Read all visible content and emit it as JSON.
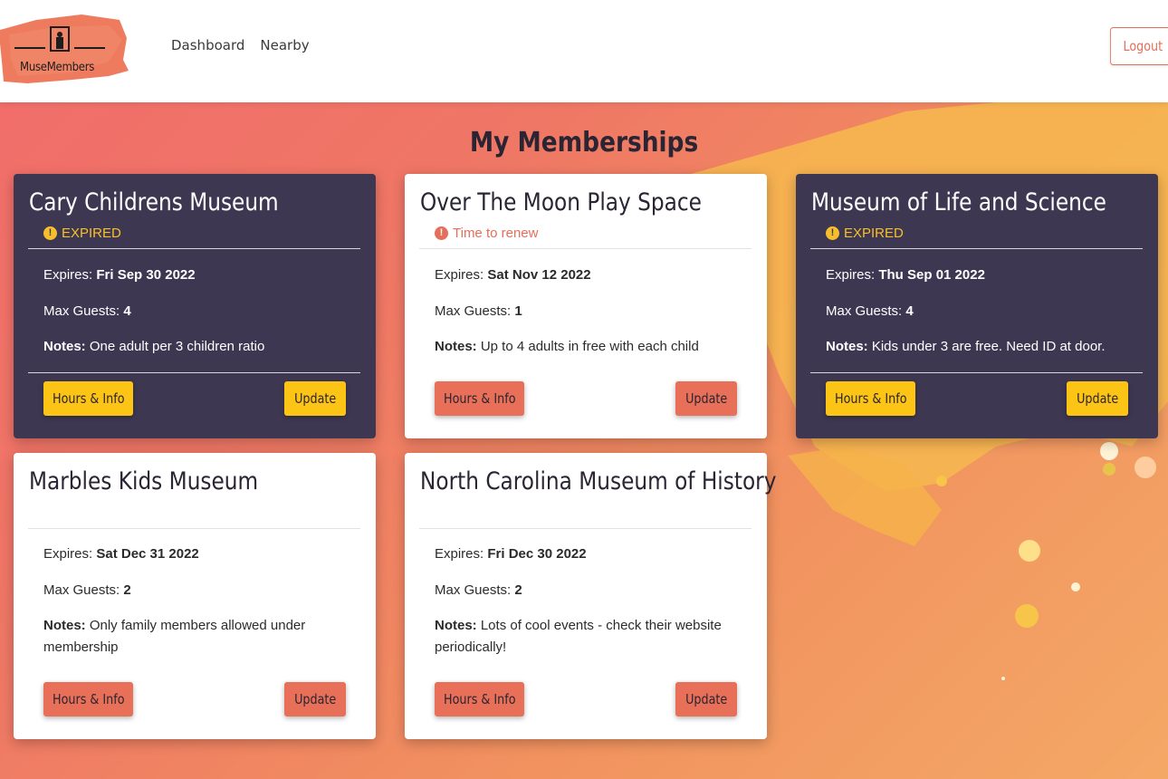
{
  "app": {
    "logo_text": "MuseMembers",
    "nav": [
      "Dashboard",
      "Nearby"
    ],
    "logout_label": "Logout"
  },
  "page_title": "My Memberships",
  "cards": [
    {
      "title": "Cary Childrens Museum",
      "status": "EXPIRED",
      "expires_label": "Expires:",
      "expires": "Fri Sep 30 2022",
      "guests_label": "Max Guests:",
      "guests": "4",
      "notes_label": "Notes:",
      "notes": "One adult per 3 children ratio",
      "hours_label": "Hours & Info",
      "update_label": "Update"
    },
    {
      "title": "Over The Moon Play Space",
      "status": "Time to renew",
      "expires_label": "Expires:",
      "expires": "Sat Nov 12 2022",
      "guests_label": "Max Guests:",
      "guests": "1",
      "notes_label": "Notes:",
      "notes": "Up to 4 adults in free with each child",
      "hours_label": "Hours & Info",
      "update_label": "Update"
    },
    {
      "title": "Museum of Life and Science",
      "status": "EXPIRED",
      "expires_label": "Expires:",
      "expires": "Thu Sep 01 2022",
      "guests_label": "Max Guests:",
      "guests": "4",
      "notes_label": "Notes:",
      "notes": "Kids under 3 are free. Need ID at door.",
      "hours_label": "Hours & Info",
      "update_label": "Update"
    },
    {
      "title": "Marbles Kids Museum",
      "status": "",
      "expires_label": "Expires:",
      "expires": "Sat Dec 31 2022",
      "guests_label": "Max Guests:",
      "guests": "2",
      "notes_label": "Notes:",
      "notes": "Only family members allowed under membership",
      "hours_label": "Hours & Info",
      "update_label": "Update"
    },
    {
      "title": "North Carolina Museum of History",
      "status": "",
      "expires_label": "Expires:",
      "expires": "Fri Dec 30 2022",
      "guests_label": "Max Guests:",
      "guests": "2",
      "notes_label": "Notes:",
      "notes": "Lots of cool events - check their website periodically!",
      "hours_label": "Hours & Info",
      "update_label": "Update"
    }
  ],
  "colors": {
    "accent": "#e87058",
    "dark_card": "#3e3752",
    "yellow": "#fcc414"
  },
  "icons": {
    "status": "alert-circle-icon",
    "logo": "museum-figure-icon"
  }
}
